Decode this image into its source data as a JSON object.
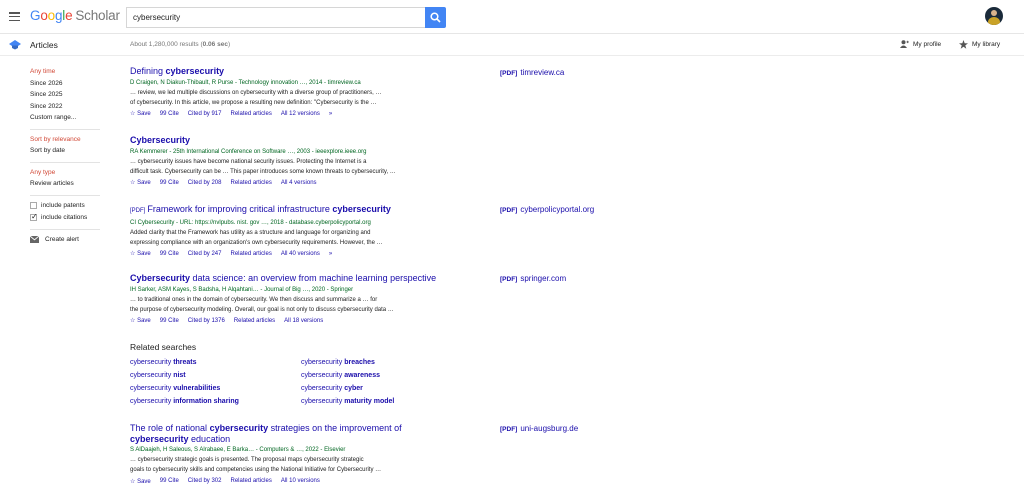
{
  "header": {
    "logo_google": "Google",
    "logo_scholar": "Scholar",
    "search_value": "cybersecurity"
  },
  "subbar": {
    "section": "Articles",
    "results_prefix": "About 1,280,000 results (",
    "results_time": "0.06 sec",
    "results_suffix": ")",
    "my_profile": "My profile",
    "my_library": "My library"
  },
  "sidebar": {
    "time_filters": [
      "Any time",
      "Since 2026",
      "Since 2025",
      "Since 2022",
      "Custom range..."
    ],
    "sort_options": [
      "Sort by relevance",
      "Sort by date"
    ],
    "type_options": [
      "Any type",
      "Review articles"
    ],
    "include_patents": "include patents",
    "include_citations": "include citations",
    "create_alert": "Create alert"
  },
  "results": [
    {
      "title_pre": "Defining ",
      "title_bold": "cybersecurity",
      "title_post": "",
      "pdf_tag": "",
      "authors": "D Craigen, N Diakun-Thibault, R Purse - Technology innovation …, 2014 - timreview.ca",
      "snippet_1": "… review, we led multiple discussions on cybersecurity with a diverse group of practitioners, …",
      "snippet_2": "of cybersecurity. In this article, we propose a resulting new definition: \"Cybersecurity is the …",
      "save": "Save",
      "cite": "Cite",
      "cited_by": "Cited by 917",
      "related": "Related articles",
      "versions": "All 12 versions",
      "side_pdf": "[PDF]",
      "side_domain": "timreview.ca"
    },
    {
      "title_pre": "",
      "title_bold": "Cybersecurity",
      "title_post": "",
      "pdf_tag": "",
      "authors": "RA Kemmerer - 25th International Conference on Software …, 2003 - ieeexplore.ieee.org",
      "snippet_1": "… cybersecurity issues have become national security issues. Protecting the Internet is a",
      "snippet_2": "difficult task. Cybersecurity can be … This paper introduces some known threats to cybersecurity, …",
      "save": "Save",
      "cite": "Cite",
      "cited_by": "Cited by 208",
      "related": "Related articles",
      "versions": "All 4 versions",
      "side_pdf": "",
      "side_domain": ""
    },
    {
      "title_pre": "Framework for improving critical infrastructure ",
      "title_bold": "cybersecurity",
      "title_post": "",
      "pdf_tag": "[PDF]",
      "authors": "CI Cybersecurity - URL: https://nvlpubs. nist. gov …, 2018 - database.cyberpolicyportal.org",
      "snippet_1": "Added clarity that the Framework has utility as a structure and language for organizing and",
      "snippet_2": "expressing compliance with an organization's own cybersecurity requirements. However, the …",
      "save": "Save",
      "cite": "Cite",
      "cited_by": "Cited by 247",
      "related": "Related articles",
      "versions": "All 40 versions",
      "side_pdf": "[PDF]",
      "side_domain": "cyberpolicyportal.org"
    },
    {
      "title_pre": "",
      "title_bold": "Cybersecurity",
      "title_post": " data science: an overview from machine learning perspective",
      "pdf_tag": "",
      "authors": "IH Sarker, ASM Kayes, S Badsha, H Alqahtani… - Journal of Big …, 2020 - Springer",
      "snippet_1": "… to traditional ones in the domain of cybersecurity. We then discuss and summarize a … for",
      "snippet_2": "the purpose of cybersecurity modeling. Overall, our goal is not only to discuss cybersecurity data …",
      "save": "Save",
      "cite": "Cite",
      "cited_by": "Cited by 1376",
      "related": "Related articles",
      "versions": "All 18 versions",
      "side_pdf": "[PDF]",
      "side_domain": "springer.com"
    },
    {
      "title_pre": "The role of national ",
      "title_bold": "cybersecurity",
      "title_post": " strategies on the improvement of",
      "title_line2_bold": "cybersecurity",
      "title_line2_post": " education",
      "pdf_tag": "",
      "authors": "S AlDaajeh, H Saleous, S Alrabaee, E Barka… - Computers & …, 2022 - Elsevier",
      "snippet_1": "… cybersecurity strategic goals is presented. The proposal maps cybersecurity strategic",
      "snippet_2": "goals to cybersecurity skills and competencies using the National Initiative for Cybersecurity …",
      "save": "Save",
      "cite": "Cite",
      "cited_by": "Cited by 302",
      "related": "Related articles",
      "versions": "All 10 versions",
      "side_pdf": "[PDF]",
      "side_domain": "uni-augsburg.de"
    }
  ],
  "related_searches": {
    "title": "Related searches",
    "items": [
      {
        "base": "cybersecurity ",
        "bold": "threats"
      },
      {
        "base": "cybersecurity ",
        "bold": "breaches"
      },
      {
        "base": "cybersecurity ",
        "bold": "nist"
      },
      {
        "base": "cybersecurity ",
        "bold": "awareness"
      },
      {
        "base": "cybersecurity ",
        "bold": "vulnerabilities"
      },
      {
        "base": "cybersecurity ",
        "bold": "cyber"
      },
      {
        "base": "cybersecurity ",
        "bold": "information sharing"
      },
      {
        "base": "cybersecurity ",
        "bold": "maturity model"
      }
    ]
  },
  "colors": {
    "link": "#1a0dab",
    "green": "#006621",
    "red": "#d14836",
    "search_button": "#4285f4"
  },
  "icons": {
    "menu": "hamburger-icon",
    "search": "search-icon",
    "profile": "person-icon",
    "library": "star-icon",
    "articles": "scholar-cap-icon",
    "alert": "envelope-icon"
  }
}
